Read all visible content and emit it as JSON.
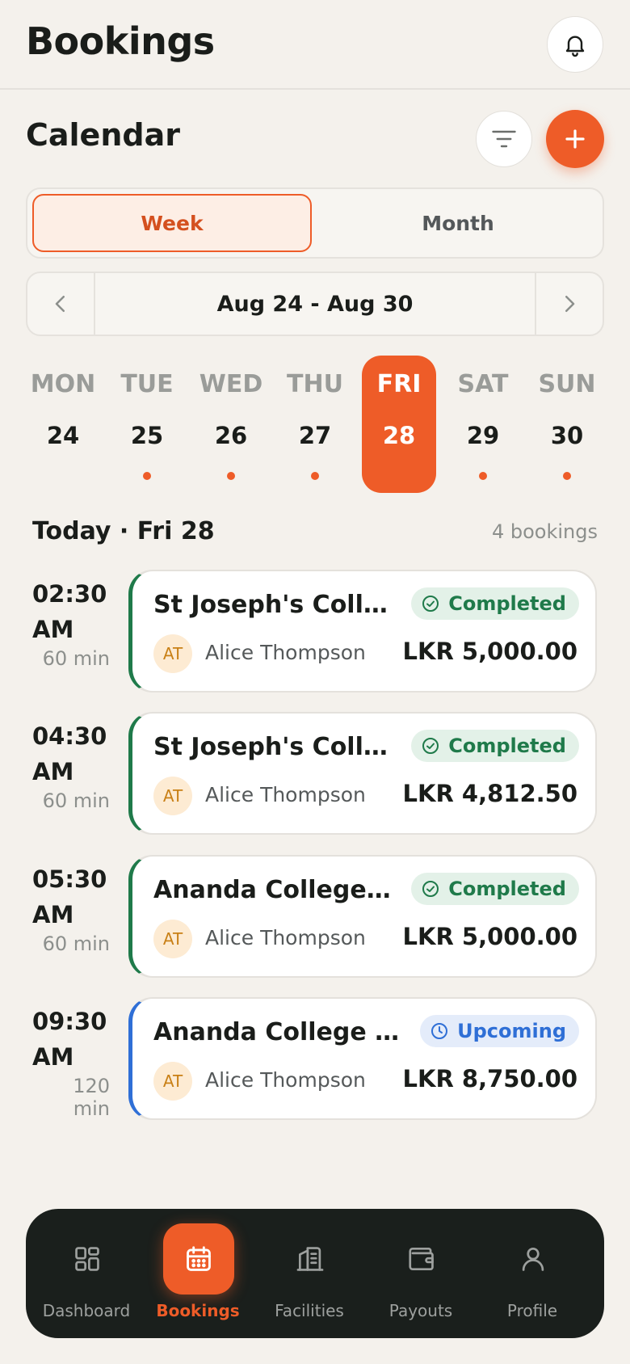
{
  "header": {
    "title": "Bookings"
  },
  "calendar": {
    "title": "Calendar",
    "view_tabs": [
      {
        "label": "Week",
        "selected": true
      },
      {
        "label": "Month",
        "selected": false
      }
    ],
    "range_label": "Aug 24 - Aug 30",
    "days": [
      {
        "name": "MON",
        "num": "24",
        "has_bookings": false,
        "selected": false
      },
      {
        "name": "TUE",
        "num": "25",
        "has_bookings": true,
        "selected": false
      },
      {
        "name": "WED",
        "num": "26",
        "has_bookings": true,
        "selected": false
      },
      {
        "name": "THU",
        "num": "27",
        "has_bookings": true,
        "selected": false
      },
      {
        "name": "FRI",
        "num": "28",
        "has_bookings": false,
        "selected": true
      },
      {
        "name": "SAT",
        "num": "29",
        "has_bookings": true,
        "selected": false
      },
      {
        "name": "SUN",
        "num": "30",
        "has_bookings": true,
        "selected": false
      }
    ]
  },
  "list": {
    "heading": "Today · Fri 28",
    "count": "4 bookings",
    "bookings": [
      {
        "time": "02:30",
        "ampm": "AM",
        "duration": "60 min",
        "title": "St Joseph's Colle…",
        "status": "Completed",
        "initials": "AT",
        "customer": "Alice Thompson",
        "amount": "LKR 5,000.00"
      },
      {
        "time": "04:30",
        "ampm": "AM",
        "duration": "60 min",
        "title": "St Joseph's Colle…",
        "status": "Completed",
        "initials": "AT",
        "customer": "Alice Thompson",
        "amount": "LKR 4,812.50"
      },
      {
        "time": "05:30",
        "ampm": "AM",
        "duration": "60 min",
        "title": "Ananda College C…",
        "status": "Completed",
        "initials": "AT",
        "customer": "Alice Thompson",
        "amount": "LKR 5,000.00"
      },
      {
        "time": "09:30",
        "ampm": "AM",
        "duration": "120 min",
        "title": "Ananda College Ba…",
        "status": "Upcoming",
        "initials": "AT",
        "customer": "Alice Thompson",
        "amount": "LKR 8,750.00"
      }
    ]
  },
  "nav": {
    "items": [
      {
        "label": "Dashboard",
        "icon": "grid-icon",
        "active": false
      },
      {
        "label": "Bookings",
        "icon": "calendar-icon",
        "active": true
      },
      {
        "label": "Facilities",
        "icon": "building-icon",
        "active": false
      },
      {
        "label": "Payouts",
        "icon": "wallet-icon",
        "active": false
      },
      {
        "label": "Profile",
        "icon": "user-icon",
        "active": false
      }
    ]
  },
  "colors": {
    "accent": "#ee5c28",
    "completed": "#1f7a4a",
    "upcoming": "#2f6fd6",
    "nav_bg": "#1a1f1c",
    "page_bg": "#f4f1ec"
  }
}
